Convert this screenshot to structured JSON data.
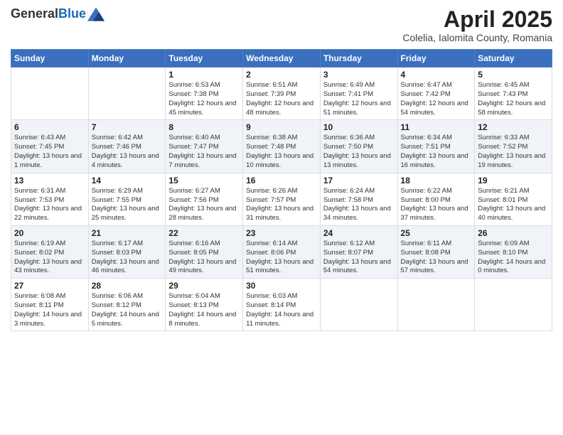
{
  "logo": {
    "general": "General",
    "blue": "Blue"
  },
  "title": "April 2025",
  "subtitle": "Colelia, Ialomita County, Romania",
  "days_header": [
    "Sunday",
    "Monday",
    "Tuesday",
    "Wednesday",
    "Thursday",
    "Friday",
    "Saturday"
  ],
  "weeks": [
    [
      {
        "day": "",
        "info": ""
      },
      {
        "day": "",
        "info": ""
      },
      {
        "day": "1",
        "info": "Sunrise: 6:53 AM\nSunset: 7:38 PM\nDaylight: 12 hours and 45 minutes."
      },
      {
        "day": "2",
        "info": "Sunrise: 6:51 AM\nSunset: 7:39 PM\nDaylight: 12 hours and 48 minutes."
      },
      {
        "day": "3",
        "info": "Sunrise: 6:49 AM\nSunset: 7:41 PM\nDaylight: 12 hours and 51 minutes."
      },
      {
        "day": "4",
        "info": "Sunrise: 6:47 AM\nSunset: 7:42 PM\nDaylight: 12 hours and 54 minutes."
      },
      {
        "day": "5",
        "info": "Sunrise: 6:45 AM\nSunset: 7:43 PM\nDaylight: 12 hours and 58 minutes."
      }
    ],
    [
      {
        "day": "6",
        "info": "Sunrise: 6:43 AM\nSunset: 7:45 PM\nDaylight: 13 hours and 1 minute."
      },
      {
        "day": "7",
        "info": "Sunrise: 6:42 AM\nSunset: 7:46 PM\nDaylight: 13 hours and 4 minutes."
      },
      {
        "day": "8",
        "info": "Sunrise: 6:40 AM\nSunset: 7:47 PM\nDaylight: 13 hours and 7 minutes."
      },
      {
        "day": "9",
        "info": "Sunrise: 6:38 AM\nSunset: 7:48 PM\nDaylight: 13 hours and 10 minutes."
      },
      {
        "day": "10",
        "info": "Sunrise: 6:36 AM\nSunset: 7:50 PM\nDaylight: 13 hours and 13 minutes."
      },
      {
        "day": "11",
        "info": "Sunrise: 6:34 AM\nSunset: 7:51 PM\nDaylight: 13 hours and 16 minutes."
      },
      {
        "day": "12",
        "info": "Sunrise: 6:33 AM\nSunset: 7:52 PM\nDaylight: 13 hours and 19 minutes."
      }
    ],
    [
      {
        "day": "13",
        "info": "Sunrise: 6:31 AM\nSunset: 7:53 PM\nDaylight: 13 hours and 22 minutes."
      },
      {
        "day": "14",
        "info": "Sunrise: 6:29 AM\nSunset: 7:55 PM\nDaylight: 13 hours and 25 minutes."
      },
      {
        "day": "15",
        "info": "Sunrise: 6:27 AM\nSunset: 7:56 PM\nDaylight: 13 hours and 28 minutes."
      },
      {
        "day": "16",
        "info": "Sunrise: 6:26 AM\nSunset: 7:57 PM\nDaylight: 13 hours and 31 minutes."
      },
      {
        "day": "17",
        "info": "Sunrise: 6:24 AM\nSunset: 7:58 PM\nDaylight: 13 hours and 34 minutes."
      },
      {
        "day": "18",
        "info": "Sunrise: 6:22 AM\nSunset: 8:00 PM\nDaylight: 13 hours and 37 minutes."
      },
      {
        "day": "19",
        "info": "Sunrise: 6:21 AM\nSunset: 8:01 PM\nDaylight: 13 hours and 40 minutes."
      }
    ],
    [
      {
        "day": "20",
        "info": "Sunrise: 6:19 AM\nSunset: 8:02 PM\nDaylight: 13 hours and 43 minutes."
      },
      {
        "day": "21",
        "info": "Sunrise: 6:17 AM\nSunset: 8:03 PM\nDaylight: 13 hours and 46 minutes."
      },
      {
        "day": "22",
        "info": "Sunrise: 6:16 AM\nSunset: 8:05 PM\nDaylight: 13 hours and 49 minutes."
      },
      {
        "day": "23",
        "info": "Sunrise: 6:14 AM\nSunset: 8:06 PM\nDaylight: 13 hours and 51 minutes."
      },
      {
        "day": "24",
        "info": "Sunrise: 6:12 AM\nSunset: 8:07 PM\nDaylight: 13 hours and 54 minutes."
      },
      {
        "day": "25",
        "info": "Sunrise: 6:11 AM\nSunset: 8:08 PM\nDaylight: 13 hours and 57 minutes."
      },
      {
        "day": "26",
        "info": "Sunrise: 6:09 AM\nSunset: 8:10 PM\nDaylight: 14 hours and 0 minutes."
      }
    ],
    [
      {
        "day": "27",
        "info": "Sunrise: 6:08 AM\nSunset: 8:11 PM\nDaylight: 14 hours and 3 minutes."
      },
      {
        "day": "28",
        "info": "Sunrise: 6:06 AM\nSunset: 8:12 PM\nDaylight: 14 hours and 5 minutes."
      },
      {
        "day": "29",
        "info": "Sunrise: 6:04 AM\nSunset: 8:13 PM\nDaylight: 14 hours and 8 minutes."
      },
      {
        "day": "30",
        "info": "Sunrise: 6:03 AM\nSunset: 8:14 PM\nDaylight: 14 hours and 11 minutes."
      },
      {
        "day": "",
        "info": ""
      },
      {
        "day": "",
        "info": ""
      },
      {
        "day": "",
        "info": ""
      }
    ]
  ]
}
